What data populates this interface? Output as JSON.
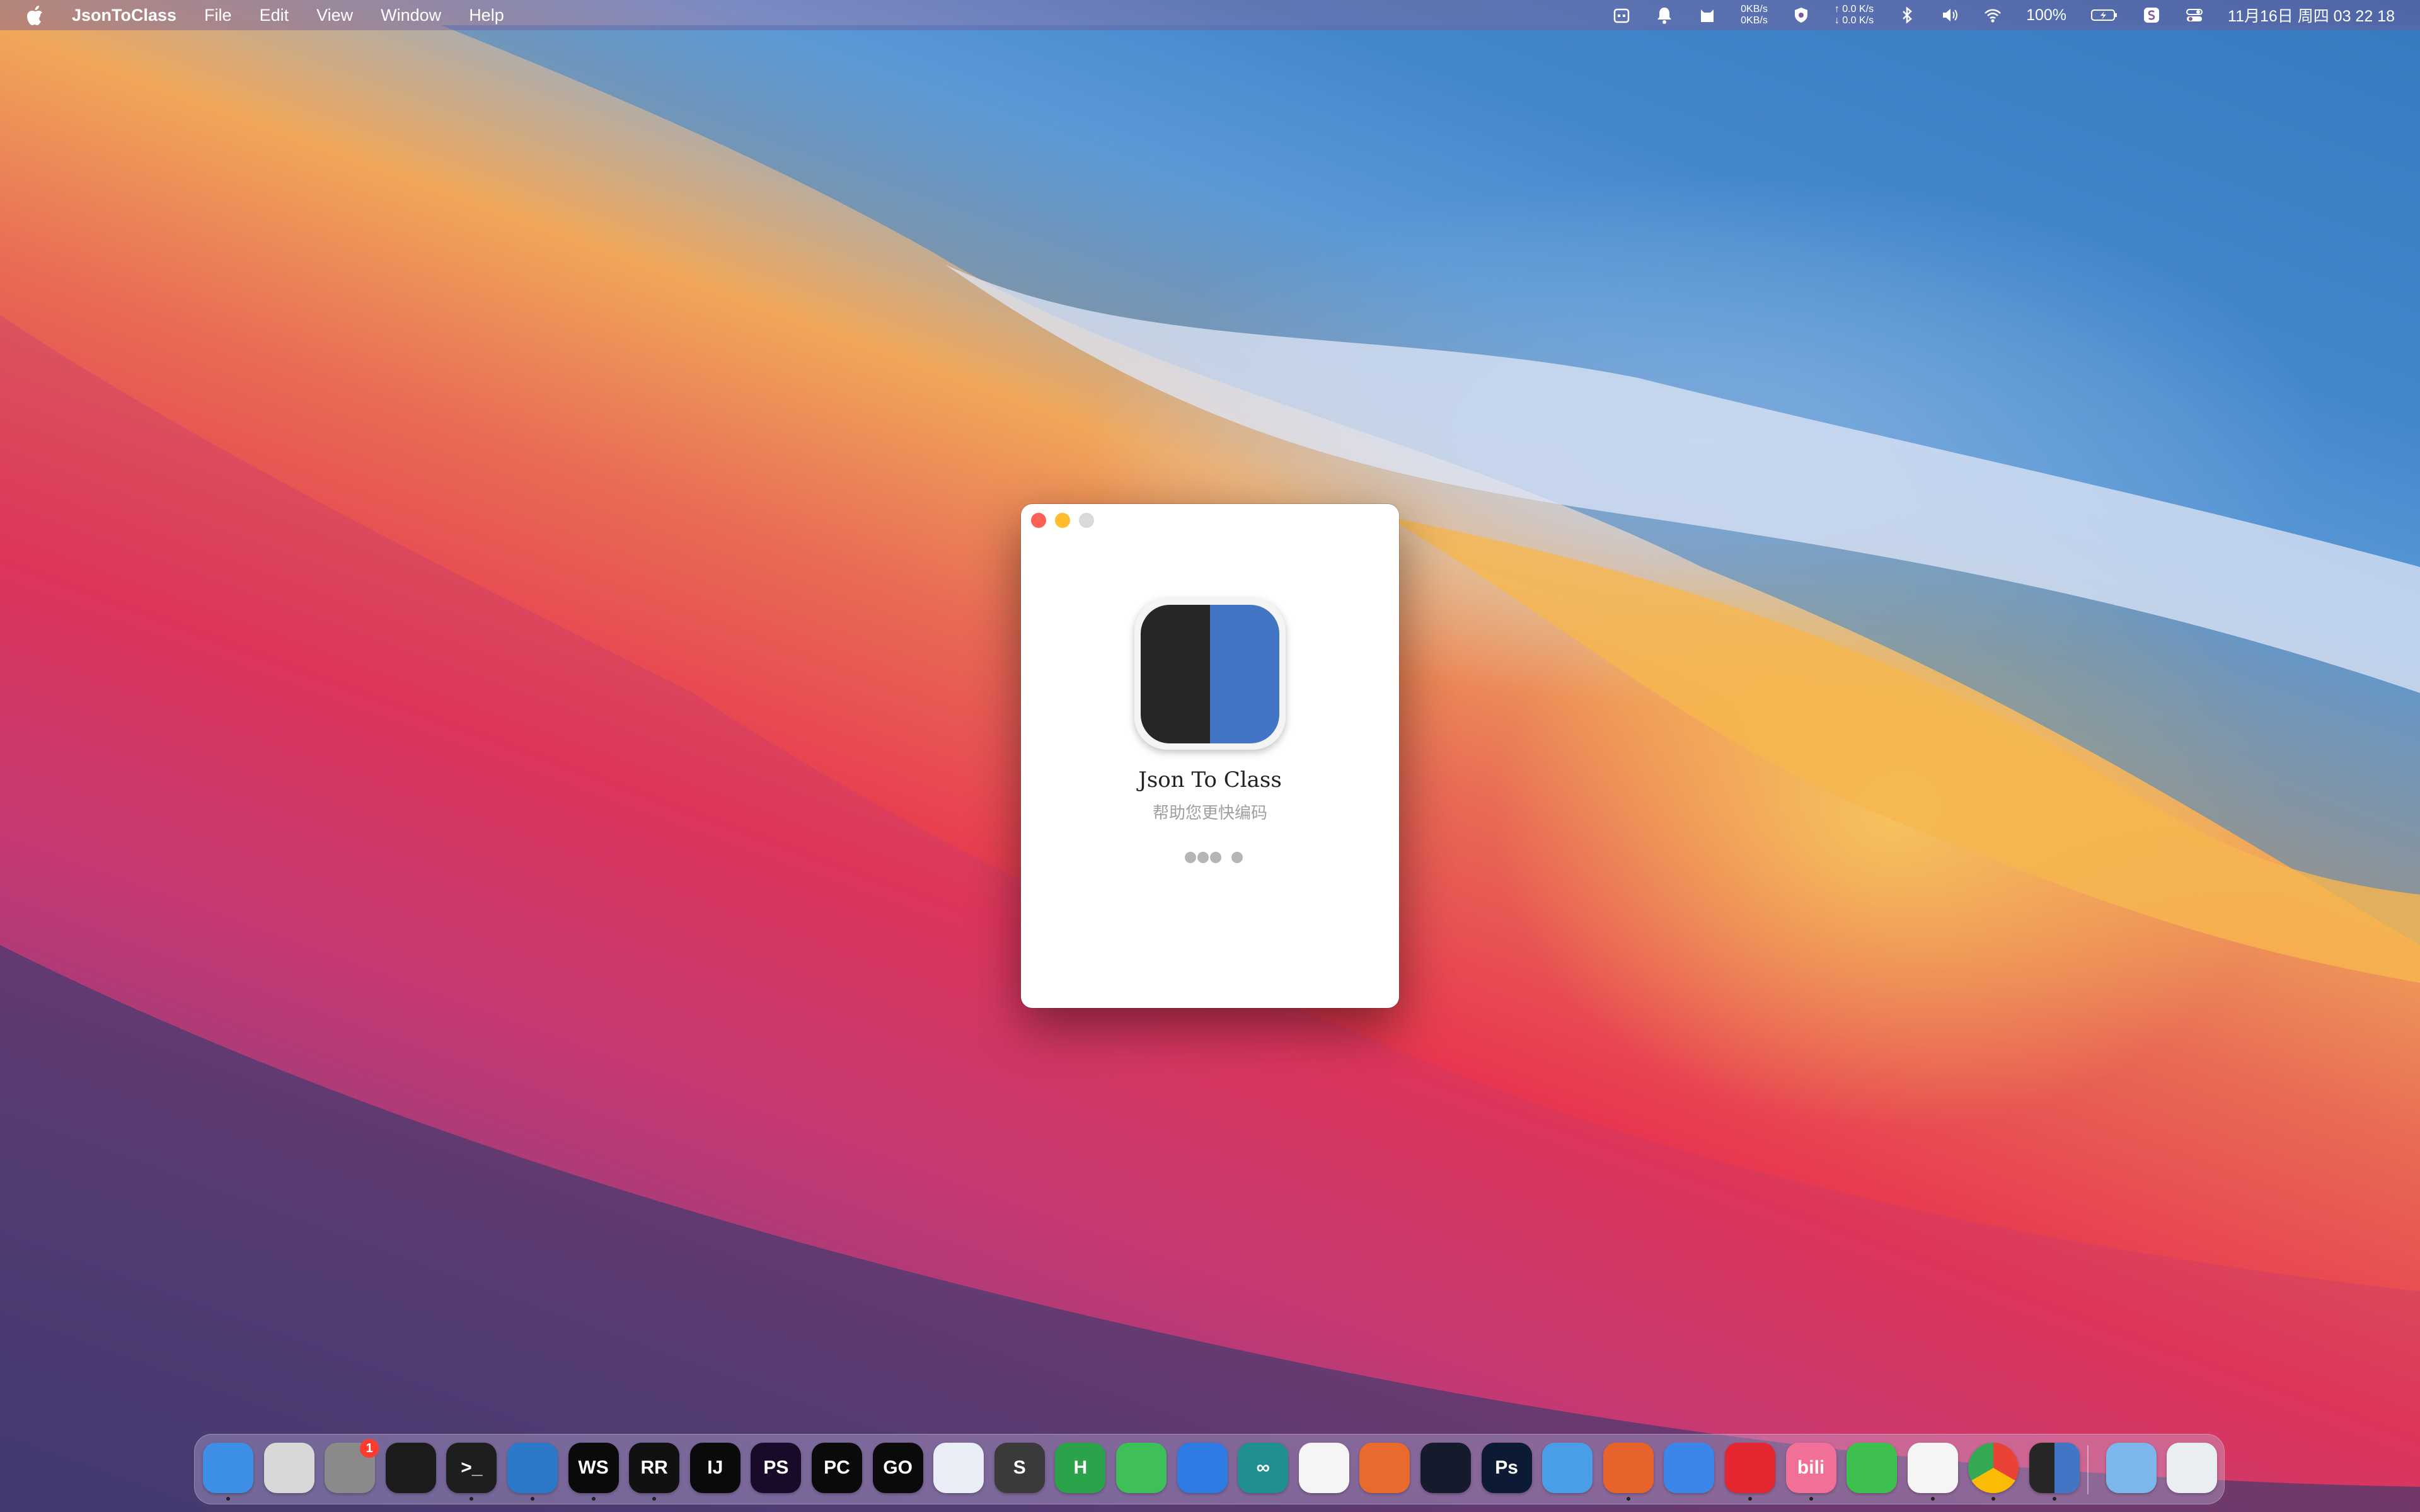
{
  "menubar": {
    "app_name": "JsonToClass",
    "menus": [
      "File",
      "Edit",
      "View",
      "Window",
      "Help"
    ],
    "net_down": "0KB/s",
    "net_up": "0KB/s",
    "speed_up": "↑ 0.0 K/s",
    "speed_down": "↓ 0.0 K/s",
    "battery": "100%",
    "datetime": "11月16日 周四  03 22 18"
  },
  "window": {
    "title": "Json To Class",
    "subtitle": "帮助您更快编码"
  },
  "dock": {
    "apps": [
      {
        "name": "finder",
        "label": "",
        "color": "#3d8fe6"
      },
      {
        "name": "launchpad",
        "label": "",
        "color": "#d8d8d8"
      },
      {
        "name": "system-preferences",
        "label": "",
        "color": "#8a8a8a",
        "badge": "1"
      },
      {
        "name": "activity-monitor",
        "label": "",
        "color": "#1c1c1c"
      },
      {
        "name": "terminal",
        "label": ">_",
        "color": "#1e1e1e"
      },
      {
        "name": "vscode",
        "label": "",
        "color": "#2b79c8"
      },
      {
        "name": "webstorm",
        "label": "WS",
        "color": "#0a0a0a"
      },
      {
        "name": "rustrover",
        "label": "RR",
        "color": "#111"
      },
      {
        "name": "intellij",
        "label": "IJ",
        "color": "#0a0a0a"
      },
      {
        "name": "phpstorm",
        "label": "PS",
        "color": "#1a0a2a"
      },
      {
        "name": "pycharm",
        "label": "PC",
        "color": "#0a0a0a"
      },
      {
        "name": "goland",
        "label": "GO",
        "color": "#0a0a0a"
      },
      {
        "name": "xcode-instruments",
        "label": "",
        "color": "#e9eef7"
      },
      {
        "name": "sublime-text",
        "label": "S",
        "color": "#3a3a3a"
      },
      {
        "name": "hbuilder",
        "label": "H",
        "color": "#2aa34a"
      },
      {
        "name": "wechat-dev",
        "label": "",
        "color": "#3fbf5a"
      },
      {
        "name": "xcode",
        "label": "",
        "color": "#2d7be3"
      },
      {
        "name": "arduino",
        "label": "∞",
        "color": "#1f8f8f"
      },
      {
        "name": "mindnode",
        "label": "",
        "color": "#f5f5f5"
      },
      {
        "name": "pencil",
        "label": "",
        "color": "#e86a2c"
      },
      {
        "name": "chatgpt",
        "label": "",
        "color": "#151a2c"
      },
      {
        "name": "photoshop",
        "label": "Ps",
        "color": "#0c1b33"
      },
      {
        "name": "eudic",
        "label": "",
        "color": "#4a9ee8"
      },
      {
        "name": "html-editor",
        "label": "",
        "color": "#e6642b"
      },
      {
        "name": "qq-cat",
        "label": "",
        "color": "#3b86e8"
      },
      {
        "name": "netease-music",
        "label": "",
        "color": "#e3262f"
      },
      {
        "name": "bilibili",
        "label": "bili",
        "color": "#f07097"
      },
      {
        "name": "wechat",
        "label": "",
        "color": "#3ec04e"
      },
      {
        "name": "qq",
        "label": "",
        "color": "#f5f5f5"
      },
      {
        "name": "chrome",
        "label": "",
        "color": "#ffffff"
      },
      {
        "name": "json-to-class",
        "label": "",
        "color": "#262626"
      },
      {
        "name": "downloads-folder",
        "label": "",
        "color": "#7cb6ea"
      },
      {
        "name": "trash",
        "label": "",
        "color": "#e9eef2"
      }
    ]
  }
}
